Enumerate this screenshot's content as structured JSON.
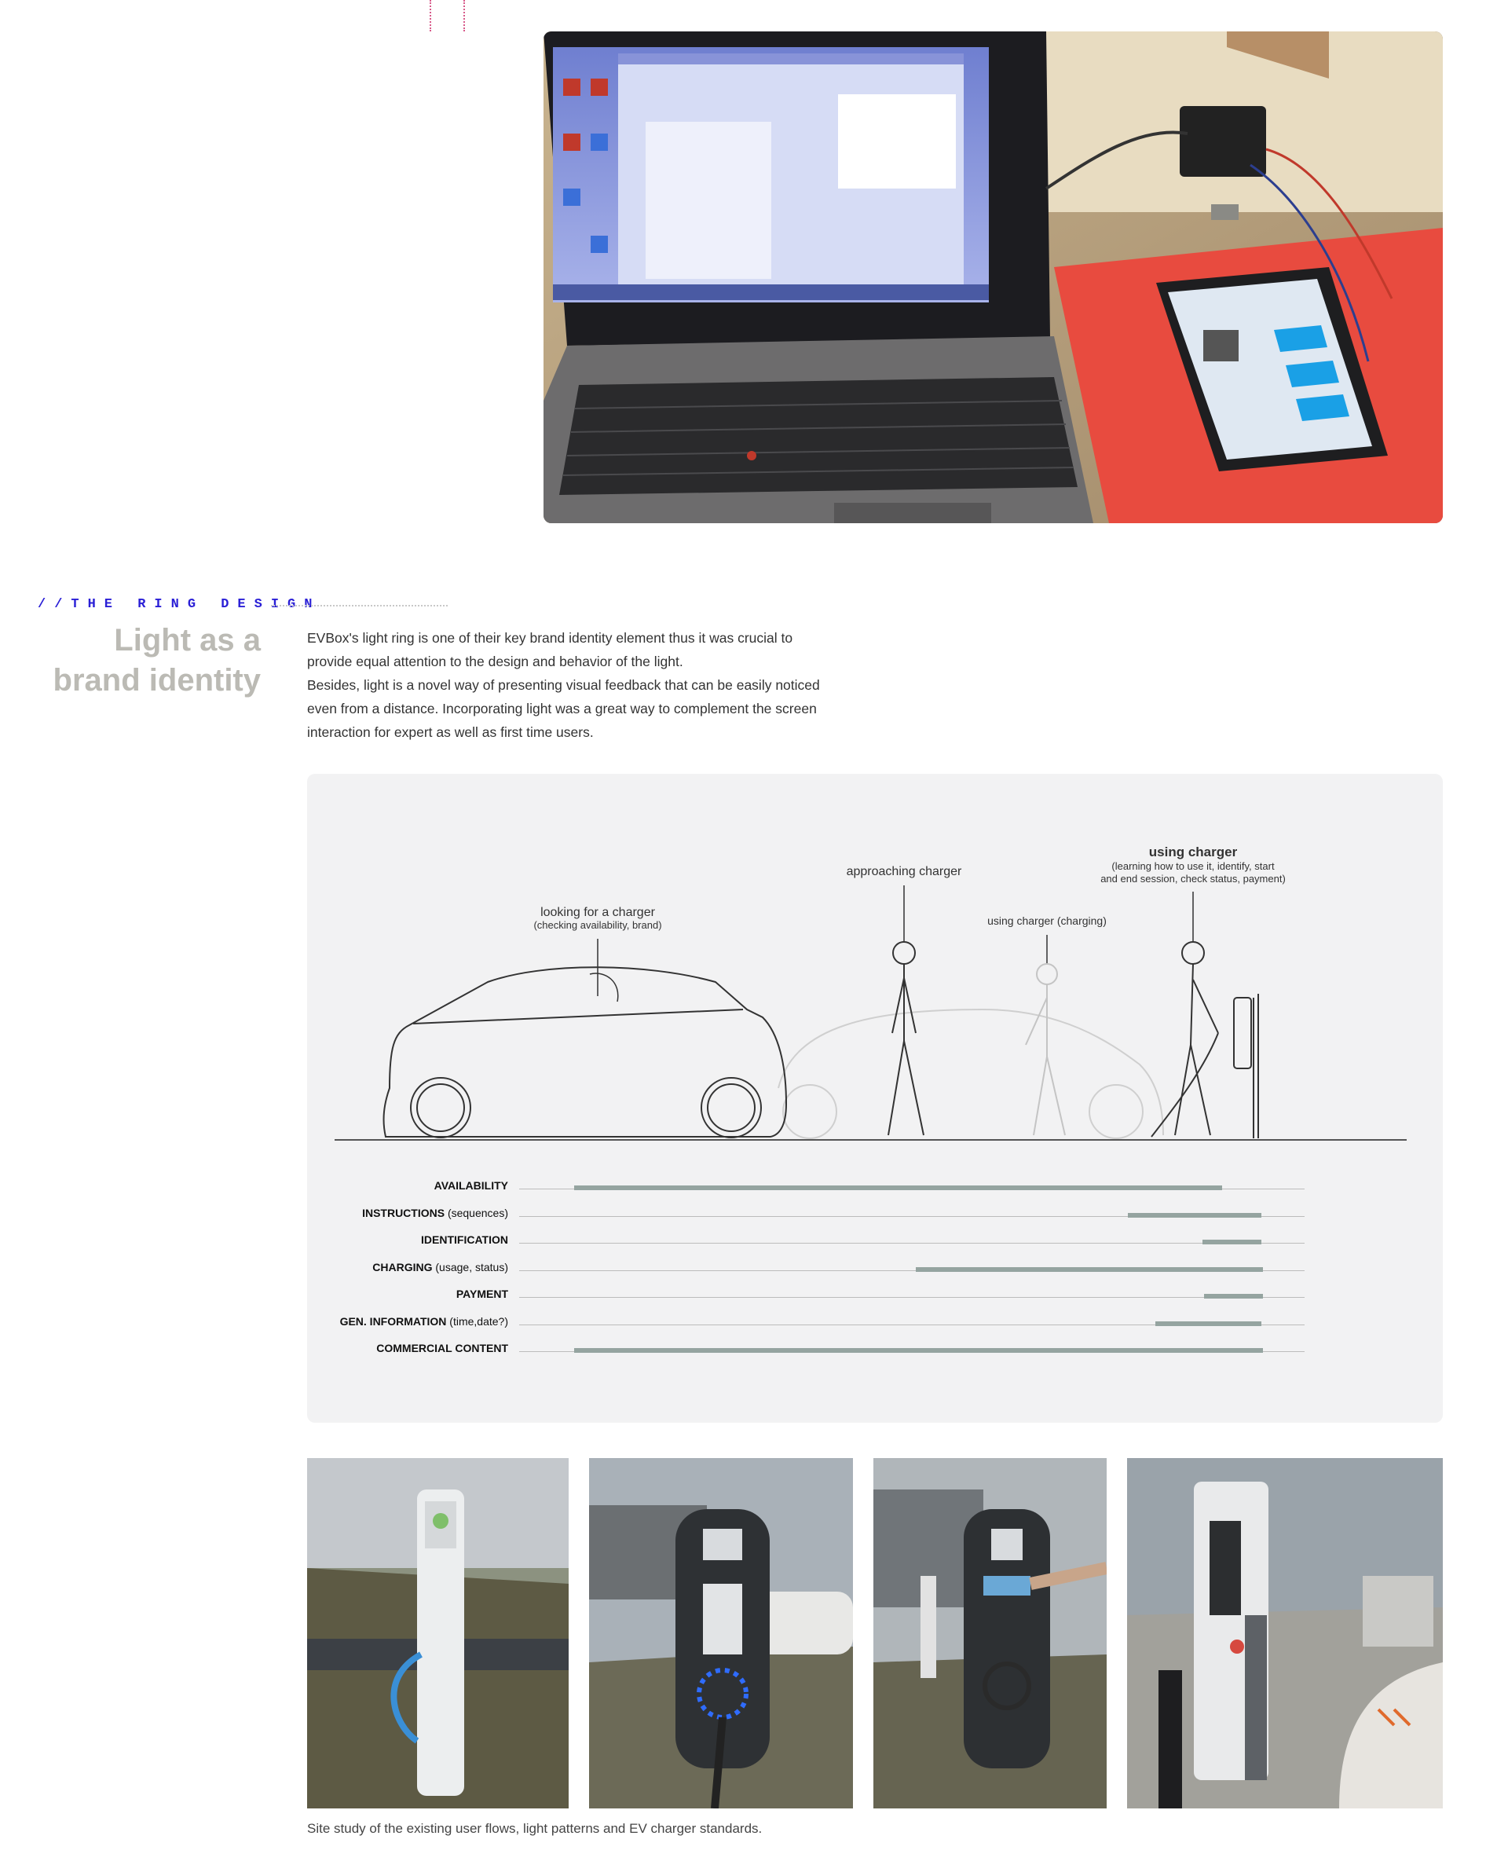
{
  "section": {
    "tag": "//THE RING DESIGN",
    "title_line1": "Light as a",
    "title_line2": "brand identity",
    "paragraph1": "EVBox's light ring is one of their key brand identity element thus it was crucial to provide equal attention to the design and behavior of the light.",
    "paragraph2": "Besides, light is a novel way of presenting visual feedback that can be easily noticed even from a distance. Incorporating light was a great way to complement the screen interaction for expert as well as first time users."
  },
  "diagram": {
    "labels": {
      "looking": "looking for a charger",
      "looking_sub": "(checking availability, brand)",
      "approaching": "approaching charger",
      "using_charging": "using charger (charging)",
      "using": "using charger",
      "using_sub1": "(learning how to use it, identify, start",
      "using_sub2": "and end session, check status, payment)"
    },
    "rows": [
      {
        "label": "AVAILABILITY",
        "detail": "",
        "start": 0.07,
        "end": 0.895
      },
      {
        "label": "INSTRUCTIONS",
        "detail": "(sequences)",
        "start": 0.775,
        "end": 0.945
      },
      {
        "label": "IDENTIFICATION",
        "detail": "",
        "start": 0.87,
        "end": 0.945
      },
      {
        "label": "CHARGING",
        "detail": "(usage, status)",
        "start": 0.505,
        "end": 0.947
      },
      {
        "label": "PAYMENT",
        "detail": "",
        "start": 0.872,
        "end": 0.947
      },
      {
        "label": "GEN. INFORMATION",
        "detail": "(time,date?)",
        "start": 0.81,
        "end": 0.945
      },
      {
        "label": "COMMERCIAL CONTENT",
        "detail": "",
        "start": 0.07,
        "end": 0.947
      }
    ]
  },
  "caption": "Site study of the existing user flows, light patterns and EV charger standards."
}
